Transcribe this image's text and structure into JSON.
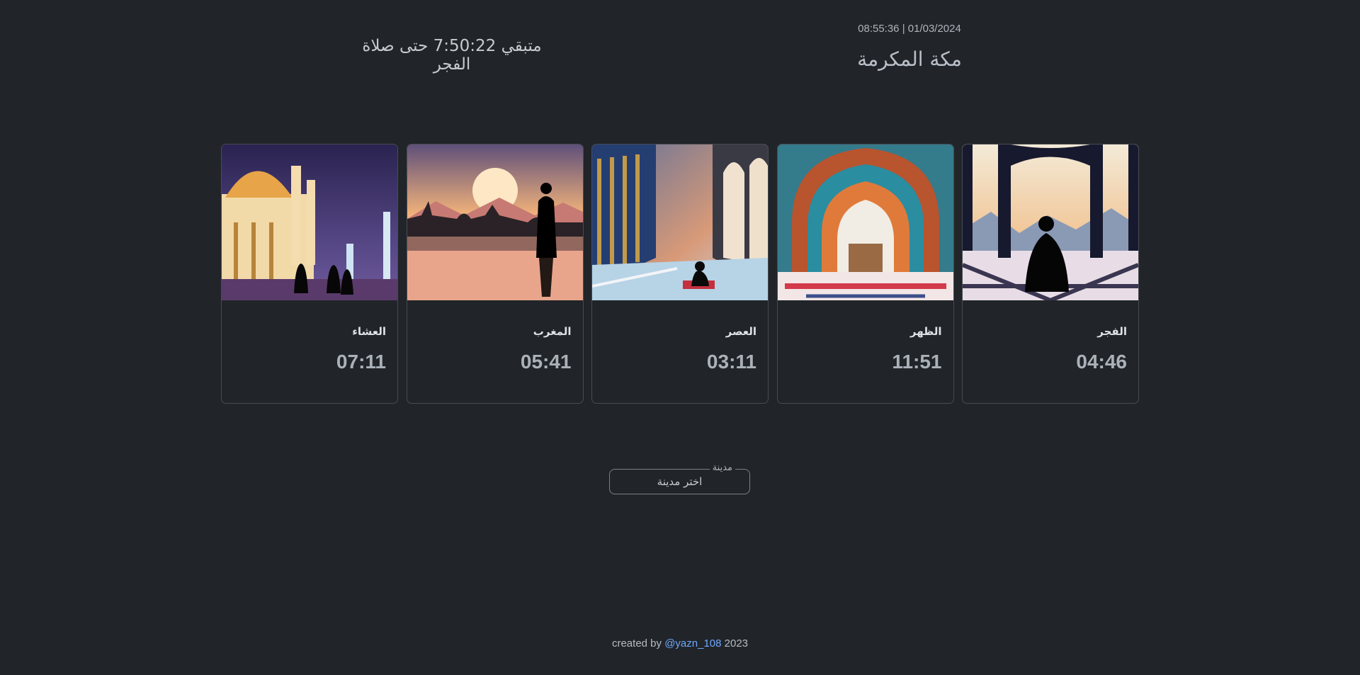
{
  "countdown": {
    "text": "متبقي 7:50:22 حتى صلاة الفجر"
  },
  "header": {
    "datetime": "08:55:36 | 01/03/2024",
    "city": "مكة المكرمة"
  },
  "prayers": [
    {
      "name": "الفجر",
      "time": "04:46",
      "image": "prayer-silhouette-arches-image"
    },
    {
      "name": "الظهر",
      "time": "11:51",
      "image": "mosque-archway-image"
    },
    {
      "name": "العصر",
      "time": "03:11",
      "image": "mosque-colonnade-image"
    },
    {
      "name": "المغرب",
      "time": "05:41",
      "image": "sunset-mosque-reflection-image"
    },
    {
      "name": "العشاء",
      "time": "07:11",
      "image": "night-mosque-image"
    }
  ],
  "city_select": {
    "label": "مدينة",
    "value": "اختر مدينة"
  },
  "footer": {
    "prefix": "created by",
    "link": "@yazn_108",
    "year": "2023"
  },
  "colors": {
    "background": "#212529",
    "link": "#6ea8fe",
    "card_border": "#474c52"
  }
}
